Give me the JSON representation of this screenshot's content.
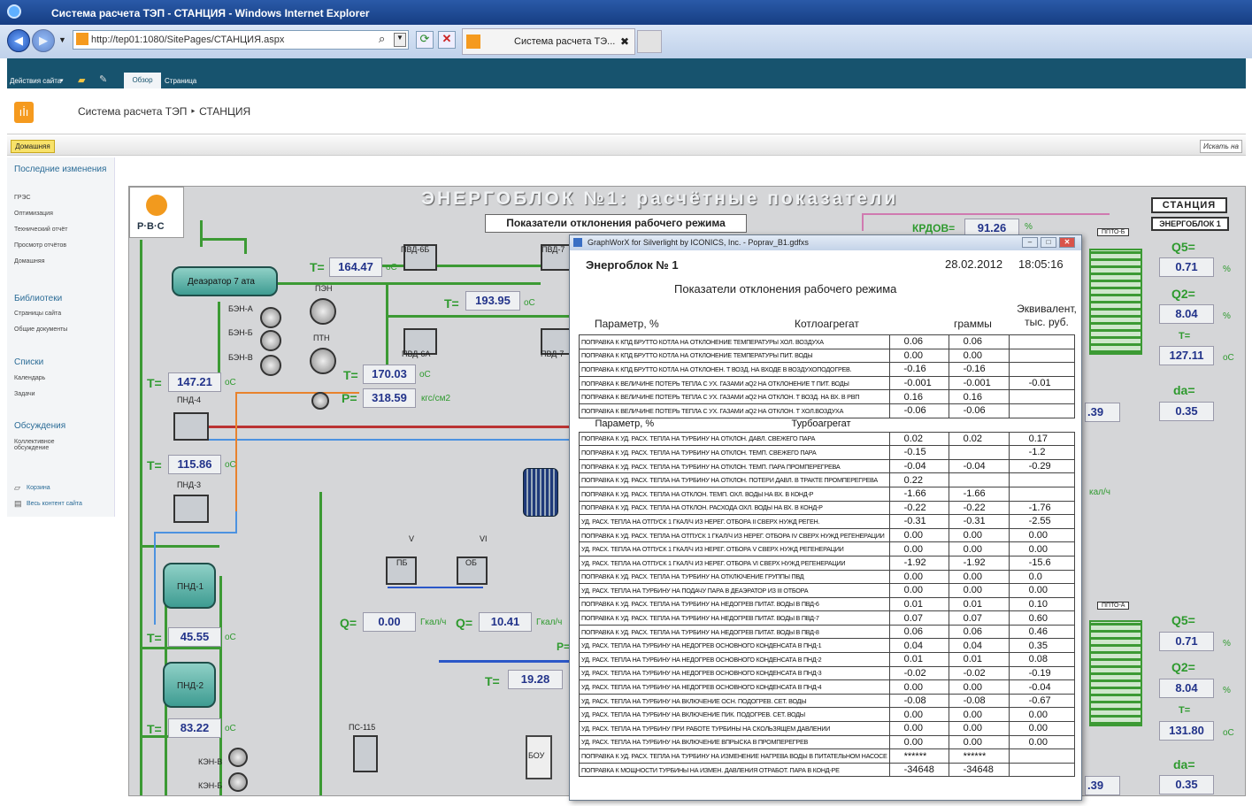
{
  "browser": {
    "window_title": "Система расчета ТЭП - СТАНЦИЯ - Windows Internet Explorer",
    "url": "http://tep01:1080/SitePages/СТАНЦИЯ.aspx",
    "tab_title": "Система расчета ТЭ...",
    "tab_close": "✖"
  },
  "sharepoint": {
    "site_actions": "Действия сайта",
    "tab_browse": "Обзор",
    "tab_page": "Страница",
    "breadcrumb": "Система расчета ТЭП ‣ СТАНЦИЯ",
    "home_tab": "Домашняя",
    "search_link": "Искать на",
    "left_nav": {
      "recent_header": "Последние изменения",
      "recent_items": [
        "ГРЭС",
        "Оптимизация",
        "Технический отчёт",
        "Просмотр отчётов",
        "Домашняя"
      ],
      "libraries_header": "Библиотеки",
      "libraries_items": [
        "Страницы сайта",
        "Общие документы"
      ],
      "lists_header": "Списки",
      "lists_items": [
        "Календарь",
        "Задачи"
      ],
      "discussions_header": "Обсуждения",
      "discussions_items": [
        "Коллективное обсуждение"
      ],
      "recycle_bin": "Корзина",
      "all_content": "Весь контент сайта"
    }
  },
  "scada": {
    "logo_text": "Р·В·С",
    "title": "ЭНЕРГОБЛОК №1: расчётные показатели",
    "deviation_button": "Показатели отклонения рабочего режима",
    "station_button": "СТАНЦИЯ",
    "unit_button": "ЭНЕРГОБЛОК 1",
    "kpd_label": "КРДОВ=",
    "kpd_value": "91.26",
    "kpd_unit": "%",
    "deaerator": "Деаэратор 7 ата",
    "equipment": {
      "pvd6b": "ПВД-6Б",
      "pvd7": "ПВД-7",
      "pvd6a": "ПВД-6А",
      "pvd7a": "ПВД-7",
      "pen": "ПЭН",
      "ptn": "ПТН",
      "ben_a": "БЭН-А",
      "ben_b": "БЭН-Б",
      "ben_v": "БЭН-В",
      "pnd4": "ПНД-4",
      "pnd3": "ПНД-3",
      "pnd1": "ПНД-1",
      "pnd2": "ПНД-2",
      "pb": "ПБ",
      "ob": "ОБ",
      "ps115": "ПС-115",
      "bou": "БОУ",
      "ken_v": "КЭН-В",
      "ken_b": "КЭН-Б",
      "ppto_b": "ППТО-Б",
      "ppto_a": "ППТО-А",
      "extraction_v": "V",
      "extraction_vi": "VI"
    },
    "readings": {
      "t_deaerator": "164.47",
      "t_pen": "193.95",
      "t_ptn": "170.03",
      "p_ptn": "318.59",
      "t_pnd4": "147.21",
      "t_pnd3": "115.86",
      "t_pnd1": "45.55",
      "t_pnd2": "83.22",
      "q_pb": "0.00",
      "q_ob": "10.41",
      "t_mid": "19.28",
      "right_top_partial": ".39",
      "right_bot_partial": ".39"
    },
    "labels": {
      "T": "T=",
      "P": "P=",
      "Q": "Q=",
      "Pdash": "P=",
      "unit_c": "oC",
      "unit_kgs": "кгс/см2",
      "unit_gcal": "Гкал/ч",
      "unit_gcal_cut": "кал/ч",
      "unit_pct": "%"
    },
    "right_panel_top": {
      "q5_label": "Q5=",
      "q5": "0.71",
      "q2_label": "Q2=",
      "q2": "8.04",
      "t_label": "T=",
      "t": "127.11",
      "da_label": "da=",
      "da": "0.35"
    },
    "right_panel_bottom": {
      "q5_label": "Q5=",
      "q5": "0.71",
      "q2_label": "Q2=",
      "q2": "8.04",
      "t_label": "T=",
      "t": "131.80",
      "da_label": "da=",
      "da": "0.35"
    }
  },
  "dialog": {
    "title": "GraphWorX for Silverlight by ICONICS, Inc. - Poprav_B1.gdfxs",
    "unit": "Энергоблок № 1",
    "date": "28.02.2012",
    "time": "18:05:16",
    "heading": "Показатели отклонения рабочего режима",
    "col_param": "Параметр, %",
    "col_boiler": "Котлоагрегат",
    "col_grams": "граммы",
    "col_equiv": "Эквивалент, тыс. руб.",
    "col_turbine": "Турбоагрегат",
    "boiler_rows": [
      {
        "p": "ПОПРАВКА К КПД БРУТТО КОТЛА НА ОТКЛОНЕНИЕ ТЕМПЕРАТУРЫ ХОЛ. ВОЗДУХА",
        "v": "0.06",
        "g": "0.06",
        "e": ""
      },
      {
        "p": "ПОПРАВКА К КПД БРУТТО КОТЛА НА ОТКЛОНЕНИЕ ТЕМПЕРАТУРЫ ПИТ. ВОДЫ",
        "v": "0.00",
        "g": "0.00",
        "e": ""
      },
      {
        "p": "ПОПРАВКА К КПД БРУТТО КОТЛА НА ОТКЛОНЕН. Т ВОЗД. НА ВХОДЕ В ВОЗДУХОПОДОГРЕВ.",
        "v": "-0.16",
        "g": "-0.16",
        "e": ""
      },
      {
        "p": "ПОПРАВКА К ВЕЛИЧИНЕ ПОТЕРЬ ТЕПЛА С УХ. ГАЗАМИ аQ2 НА ОТКЛОНЕНИЕ Т ПИТ. ВОДЫ",
        "v": "-0.001",
        "g": "-0.001",
        "e": "-0.01"
      },
      {
        "p": "ПОПРАВКА К ВЕЛИЧИНЕ ПОТЕРЬ ТЕПЛА С УХ. ГАЗАМИ аQ2 НА ОТКЛОН. Т ВОЗД. НА ВХ. В РВП",
        "v": "0.16",
        "g": "0.16",
        "e": ""
      },
      {
        "p": "ПОПРАВКА К ВЕЛИЧИНЕ ПОТЕРЬ ТЕПЛА С УХ. ГАЗАМИ аQ2 НА ОТКЛОН. Т ХОЛ.ВОЗДУХА",
        "v": "-0.06",
        "g": "-0.06",
        "e": ""
      }
    ],
    "turbine_rows": [
      {
        "p": "ПОПРАВКА К УД. РАСХ. ТЕПЛА НА ТУРБИНУ НА ОТКЛОН. ДАВЛ. СВЕЖЕГО ПАРА",
        "v": "0.02",
        "g": "0.02",
        "e": "0.17"
      },
      {
        "p": "ПОПРАВКА К УД. РАСХ. ТЕПЛА НА ТУРБИНУ НА ОТКЛОН. ТЕМП. СВЕЖЕГО ПАРА",
        "v": "-0.15",
        "g": "",
        "e": "-1.2"
      },
      {
        "p": "ПОПРАВКА К УД. РАСХ. ТЕПЛА НА ТУРБИНУ НА ОТКЛОН. ТЕМП. ПАРА ПРОМПЕРЕГРЕВА",
        "v": "-0.04",
        "g": "-0.04",
        "e": "-0.29"
      },
      {
        "p": "ПОПРАВКА К УД. РАСХ. ТЕПЛА НА ТУРБИНУ НА ОТКЛОН. ПОТЕРИ ДАВЛ. В ТРАКТЕ ПРОМПЕРЕГРЕВА",
        "v": "0.22",
        "g": "",
        "e": ""
      },
      {
        "p": "ПОПРАВКА К УД. РАСХ. ТЕПЛА НА ОТКЛОН. ТЕМП. ОХЛ. ВОДЫ НА ВХ. В КОНД-Р",
        "v": "-1.66",
        "g": "-1.66",
        "e": ""
      },
      {
        "p": "ПОПРАВКА К УД. РАСХ. ТЕПЛА НА ОТКЛОН. РАСХОДА ОХЛ. ВОДЫ НА ВХ. В КОНД-Р",
        "v": "-0.22",
        "g": "-0.22",
        "e": "-1.76"
      },
      {
        "p": "УД. РАСХ. ТЕПЛА НА ОТПУСК 1 ГКАЛ/Ч ИЗ НЕРЕГ. ОТБОРА II СВЕРХ НУЖД РЕГЕН.",
        "v": "-0.31",
        "g": "-0.31",
        "e": "-2.55"
      },
      {
        "p": "ПОПРАВКА К УД. РАСХ. ТЕПЛА НА ОТПУСК 1 ГКАЛ/Ч ИЗ НЕРЕГ. ОТБОРА IV СВЕРХ НУЖД РЕГЕНЕРАЦИИ",
        "v": "0.00",
        "g": "0.00",
        "e": "0.00"
      },
      {
        "p": "УД. РАСХ. ТЕПЛА НА ОТПУСК 1 ГКАЛ/Ч ИЗ НЕРЕГ. ОТБОРА V СВЕРХ НУЖД РЕГЕНЕРАЦИИ",
        "v": "0.00",
        "g": "0.00",
        "e": "0.00"
      },
      {
        "p": "УД. РАСХ. ТЕПЛА НА ОТПУСК 1 ГКАЛ/Ч ИЗ НЕРЕГ. ОТБОРА VI СВЕРХ НУЖД РЕГЕНЕРАЦИИ",
        "v": "-1.92",
        "g": "-1.92",
        "e": "-15.6"
      },
      {
        "p": "ПОПРАВКА К УД. РАСХ. ТЕПЛА НА ТУРБИНУ НА ОТКЛЮЧЕНИЕ ГРУППЫ ПВД",
        "v": "0.00",
        "g": "0.00",
        "e": "0.0"
      },
      {
        "p": "УД. РАСХ. ТЕПЛА НА ТУРБИНУ НА ПОДАЧУ ПАРА В ДЕАЭРАТОР ИЗ III ОТБОРА",
        "v": "0.00",
        "g": "0.00",
        "e": "0.00"
      },
      {
        "p": "ПОПРАВКА К УД. РАСХ. ТЕПЛА НА ТУРБИНУ НА НЕДОГРЕВ ПИТАТ. ВОДЫ В ПВД-6",
        "v": "0.01",
        "g": "0.01",
        "e": "0.10"
      },
      {
        "p": "ПОПРАВКА К УД. РАСХ. ТЕПЛА НА ТУРБИНУ НА НЕДОГРЕВ ПИТАТ. ВОДЫ В ПВД-7",
        "v": "0.07",
        "g": "0.07",
        "e": "0.60"
      },
      {
        "p": "ПОПРАВКА К УД. РАСХ. ТЕПЛА НА ТУРБИНУ НА НЕДОГРЕВ ПИТАТ. ВОДЫ В ПВД-8",
        "v": "0.06",
        "g": "0.06",
        "e": "0.46"
      },
      {
        "p": "УД. РАСХ. ТЕПЛА НА ТУРБИНУ НА НЕДОГРЕВ ОСНОВНОГО КОНДЕНСАТА В ПНД-1",
        "v": "0.04",
        "g": "0.04",
        "e": "0.35"
      },
      {
        "p": "УД. РАСХ. ТЕПЛА НА ТУРБИНУ НА НЕДОГРЕВ ОСНОВНОГО КОНДЕНСАТА В ПНД-2",
        "v": "0.01",
        "g": "0.01",
        "e": "0.08"
      },
      {
        "p": "УД. РАСХ. ТЕПЛА НА ТУРБИНУ НА НЕДОГРЕВ ОСНОВНОГО КОНДЕНСАТА В ПНД-3",
        "v": "-0.02",
        "g": "-0.02",
        "e": "-0.19"
      },
      {
        "p": "УД. РАСХ. ТЕПЛА НА ТУРБИНУ НА НЕДОГРЕВ ОСНОВНОГО КОНДЕНСАТА В ПНД-4",
        "v": "0.00",
        "g": "0.00",
        "e": "-0.04"
      },
      {
        "p": "УД. РАСХ. ТЕПЛА НА ТУРБИНУ НА ВКЛЮЧЕНИЕ ОСН. ПОДОГРЕВ. СЕТ. ВОДЫ",
        "v": "-0.08",
        "g": "-0.08",
        "e": "-0.67"
      },
      {
        "p": "УД. РАСХ. ТЕПЛА НА ТУРБИНУ НА ВКЛЮЧЕНИЕ ПИК. ПОДОГРЕВ. СЕТ. ВОДЫ",
        "v": "0.00",
        "g": "0.00",
        "e": "0.00"
      },
      {
        "p": "УД. РАСХ. ТЕПЛА НА ТУРБИНУ ПРИ РАБОТЕ ТУРБИНЫ НА СКОЛЬЗЯЩЕМ ДАВЛЕНИИ",
        "v": "0.00",
        "g": "0.00",
        "e": "0.00"
      },
      {
        "p": "УД. РАСХ. ТЕПЛА НА ТУРБИНУ НА ВКЛЮЧЕНИЕ ВПРЫСКА В ПРОМПЕРЕГРЕВ",
        "v": "0.00",
        "g": "0.00",
        "e": "0.00"
      },
      {
        "p": "ПОПРАВКА К УД. РАСХ. ТЕПЛА НА ТУРБИНУ НА ИЗМЕНЕНИЕ НАГРЕВА ВОДЫ В ПИТАТЕЛЬНОМ НАСОСЕ",
        "v": "******",
        "g": "******",
        "e": ""
      },
      {
        "p": "ПОПРАВКА К МОЩНОСТИ ТУРБИНЫ НА ИЗМЕН. ДАВЛЕНИЯ ОТРАБОТ. ПАРА В КОНД-РЕ",
        "v": "-34648",
        "g": "-34648",
        "e": ""
      }
    ]
  }
}
